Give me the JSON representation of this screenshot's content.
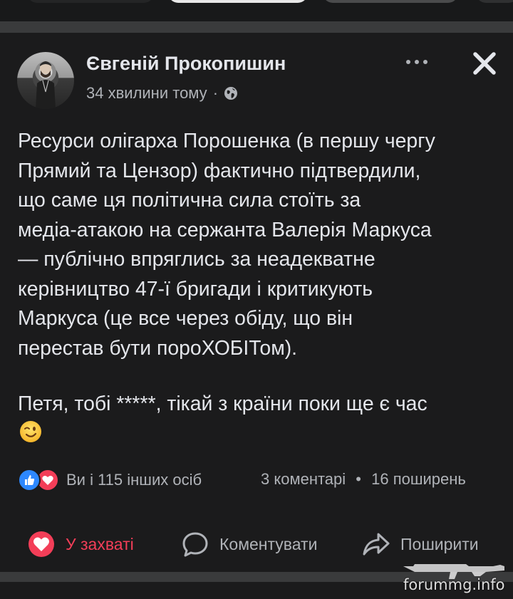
{
  "post": {
    "author": "Євгеній Прокопишин",
    "time": "34 хвилини тому",
    "dot": "·",
    "body_paragraph_1": "Ресурси олігарха Порошенка (в першу чергу\nПрямий та Цензор) фактично підтвердили,\nщо саме ця політична сила стоїть за\nмедіа-атакою на сержанта Валерія Маркуса\n— публічно впряглись за неадекватне\nкерівництво 47-ї бригади і критикують\nМаркуса (це все через обіду, що він\nперестав бути пороХОБІТом).",
    "body_paragraph_2": "Петя, тобі *****, тікай з країни поки ще є час",
    "emoji": "wink-emoji"
  },
  "reactions": {
    "summary": "Ви і 115 інших осіб",
    "comments": "3 коментарі",
    "sep": "•",
    "shares": "16 поширень"
  },
  "actions": {
    "love": "У захваті",
    "comment": "Коментувати",
    "share": "Поширити"
  },
  "watermark": {
    "text": "forummg.info"
  },
  "colors": {
    "background": "#1b1b1c",
    "text": "#e4e6eb",
    "secondary": "#b0b3b8",
    "love": "#f33e58",
    "like": "#2d88ff"
  }
}
